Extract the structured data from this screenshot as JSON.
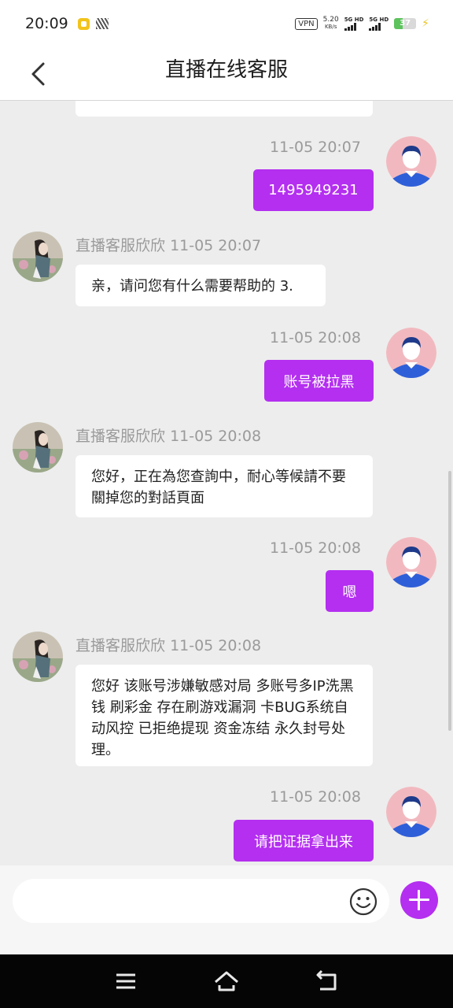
{
  "status_bar": {
    "time": "20:09",
    "vpn": "VPN",
    "speed_value": "5.20",
    "speed_unit": "KB/s",
    "sim1_label": "5G HD",
    "sim2_label": "5G HD",
    "battery": "37",
    "battery_level": 0.37,
    "battery_color": "#5cc35c"
  },
  "header": {
    "title": "直播在线客服",
    "back_icon": "chevron-left-icon"
  },
  "colors": {
    "accent": "#b42ff0",
    "time_text": "#9a9a9a"
  },
  "messages": [
    {
      "side": "out",
      "time": "11-05 20:07",
      "text": "1495949231"
    },
    {
      "side": "in",
      "sender": "直播客服欣欣",
      "time": "11-05 20:07",
      "text": "亲，请问您有什么需要帮助的 3."
    },
    {
      "side": "out",
      "time": "11-05 20:08",
      "text": "账号被拉黑"
    },
    {
      "side": "in",
      "sender": "直播客服欣欣",
      "time": "11-05 20:08",
      "text": "您好，正在為您查詢中，耐心等候請不要關掉您的對話頁面"
    },
    {
      "side": "out",
      "time": "11-05 20:08",
      "text": "嗯"
    },
    {
      "side": "in",
      "sender": "直播客服欣欣",
      "time": "11-05 20:08",
      "text": "您好 该账号涉嫌敏感对局 多账号多IP洗黑钱 刷彩金 存在刷游戏漏洞 卡BUG系统自动风控 已拒绝提现 资金冻结 永久封号处理。"
    },
    {
      "side": "out",
      "time": "11-05 20:08",
      "text": "请把证据拿出来"
    }
  ],
  "input": {
    "value": "",
    "placeholder": "",
    "emoji_icon": "smiley-icon",
    "plus_icon": "plus-icon"
  },
  "nav_bar": {
    "icons": [
      "menu-icon",
      "home-icon",
      "back-icon"
    ]
  }
}
